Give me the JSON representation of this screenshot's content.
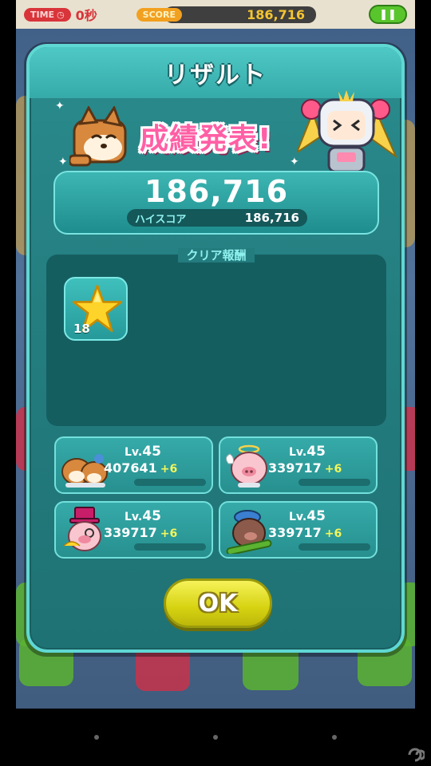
{
  "hud": {
    "time_label": "TIME",
    "time_value": "0秒",
    "score_label": "SCORE",
    "score_value": "186,716",
    "pause_icon": "pause-icon"
  },
  "dialog": {
    "title": "リザルト",
    "announcement": "成績発表!",
    "score": "186,716",
    "highscore_label": "ハイスコア",
    "highscore_value": "186,716",
    "reward_title": "クリア報酬",
    "reward": {
      "icon": "star-icon",
      "count": "18"
    },
    "characters": [
      {
        "name_icon": "dog-pair-icon",
        "level_prefix": "Lv.",
        "level": "45",
        "exp": "407641",
        "gain": "+6",
        "progress": 0.0
      },
      {
        "name_icon": "angel-pig-icon",
        "level_prefix": "Lv.",
        "level": "45",
        "exp": "339717",
        "gain": "+6",
        "progress": 0.0
      },
      {
        "name_icon": "magician-pig-icon",
        "level_prefix": "Lv.",
        "level": "45",
        "exp": "339717",
        "gain": "+6",
        "progress": 0.0
      },
      {
        "name_icon": "skater-pig-icon",
        "level_prefix": "Lv.",
        "level": "45",
        "exp": "339717",
        "gain": "+6",
        "progress": 0.0
      }
    ],
    "ok_label": "OK"
  },
  "colors": {
    "dialog_teal": "#237c7e",
    "accent_cyan": "#8ff1ee",
    "announcement_pink": "#ff5fa5",
    "ok_yellow": "#e8e42a"
  }
}
